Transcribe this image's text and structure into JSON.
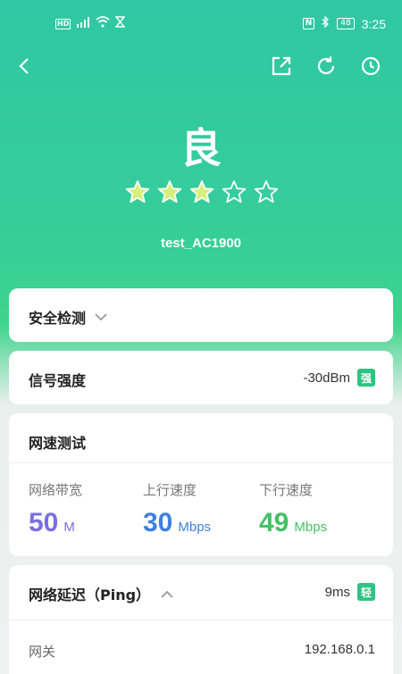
{
  "status_bar": {
    "hd": "HD",
    "signal": "⁴⁶",
    "time": "3:25",
    "battery": "48",
    "nfc": "N"
  },
  "toolbar": {
    "icons": [
      "back-icon",
      "share-icon",
      "refresh-icon",
      "history-icon"
    ]
  },
  "result": {
    "grade": "良",
    "rating": 3,
    "rating_max": 5,
    "ssid": "test_AC1900"
  },
  "security": {
    "title": "安全检测"
  },
  "signal": {
    "title": "信号强度",
    "value": "-30dBm",
    "tag": "强"
  },
  "speed": {
    "title": "网速测试",
    "metrics": [
      {
        "label": "网络带宽",
        "value": "50",
        "unit": "M",
        "color": "#7b6fe0"
      },
      {
        "label": "上行速度",
        "value": "30",
        "unit": "Mbps",
        "color": "#3f7fe0"
      },
      {
        "label": "下行速度",
        "value": "49",
        "unit": "Mbps",
        "color": "#44c065"
      }
    ]
  },
  "latency": {
    "title": "网络延迟（Ping）",
    "value": "9ms",
    "tag": "轻",
    "rows": [
      {
        "label": "网关",
        "value": "192.168.0.1"
      }
    ]
  },
  "colors": {
    "accent": "#2ec482",
    "star_filled": "#d8ef7a",
    "header_gradient_top": "#2fc7a4"
  }
}
